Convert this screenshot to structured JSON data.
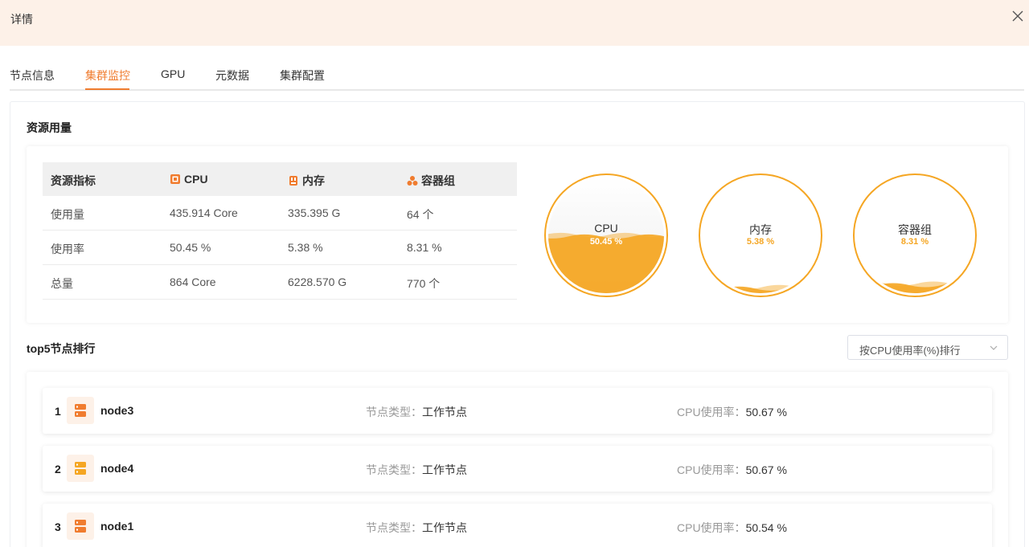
{
  "header": {
    "title": "详情"
  },
  "tabs": [
    {
      "label": "节点信息"
    },
    {
      "label": "集群监控"
    },
    {
      "label": "GPU"
    },
    {
      "label": "元数据"
    },
    {
      "label": "集群配置"
    }
  ],
  "active_tab": "集群监控",
  "resource": {
    "title": "资源用量",
    "headers": [
      "资源指标",
      "CPU",
      "内存",
      "容器组"
    ],
    "rows": [
      [
        "使用量",
        "435.914 Core",
        "335.395 G",
        "64 个"
      ],
      [
        "使用率",
        "50.45 %",
        "5.38 %",
        "8.31 %"
      ],
      [
        "总量",
        "864 Core",
        "6228.570 G",
        "770 个"
      ]
    ],
    "gauges": [
      {
        "label": "CPU",
        "value": "50.45 %",
        "fraction": 0.5045
      },
      {
        "label": "内存",
        "value": "5.38 %",
        "fraction": 0.0538
      },
      {
        "label": "容器组",
        "value": "8.31 %",
        "fraction": 0.0831
      }
    ]
  },
  "top5": {
    "title": "top5节点排行",
    "sort_select": "按CPU使用率(%)排行",
    "type_label": "节点类型：",
    "usage_label": "CPU使用率：",
    "nodes": [
      {
        "rank": "1",
        "name": "node3",
        "type": "工作节点",
        "usage": "50.67 %",
        "color": "#f07c2f"
      },
      {
        "rank": "2",
        "name": "node4",
        "type": "工作节点",
        "usage": "50.67 %",
        "color": "#f5a623"
      },
      {
        "rank": "3",
        "name": "node1",
        "type": "工作节点",
        "usage": "50.54 %",
        "color": "#f07c2f"
      }
    ]
  },
  "colors": {
    "accent": "#f07c2f",
    "gauge": "#f5a623",
    "header_bg": "#fdf1e8"
  }
}
